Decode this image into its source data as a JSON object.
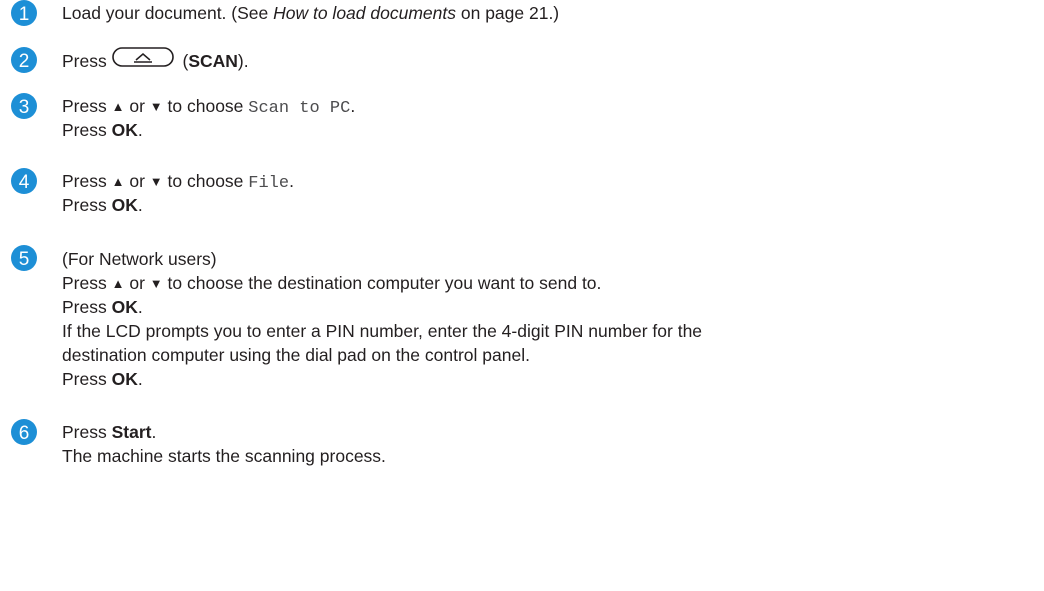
{
  "accent_color": "#1d8fd6",
  "step_icon": "step-number-badge",
  "scan_key_icon": "scan-key-icon",
  "steps": [
    {
      "number": "1",
      "line1": {
        "a": "Load your document. (See ",
        "italic": "How to load documents",
        "b": " on page 21.)"
      }
    },
    {
      "number": "2",
      "line1": {
        "a": "Press",
        "b": " (",
        "bold": "SCAN",
        "c": ")."
      }
    },
    {
      "number": "3",
      "line1": {
        "a": "Press ",
        "up": "▲",
        "or": " or ",
        "down": "▼",
        "b": " to choose ",
        "mono": "Scan to PC",
        "c": "."
      },
      "line2": {
        "a": "Press ",
        "bold": "OK",
        "b": "."
      }
    },
    {
      "number": "4",
      "line1": {
        "a": "Press ",
        "up": "▲",
        "or": " or ",
        "down": "▼",
        "b": " to choose ",
        "mono": "File",
        "c": "."
      },
      "line2": {
        "a": "Press ",
        "bold": "OK",
        "b": "."
      }
    },
    {
      "number": "5",
      "line1": "(For Network users)",
      "line2": {
        "a": "Press ",
        "up": "▲",
        "or": " or ",
        "down": "▼",
        "b": " to choose the destination computer you want to send to."
      },
      "line3": {
        "a": "Press ",
        "bold": "OK",
        "b": "."
      },
      "line4": "If the LCD prompts you to enter a PIN number, enter the 4-digit PIN number for the",
      "line5": "destination computer using the dial pad on the control panel.",
      "line6": {
        "a": "Press ",
        "bold": "OK",
        "b": "."
      }
    },
    {
      "number": "6",
      "line1": {
        "a": "Press ",
        "bold": "Start",
        "b": "."
      },
      "line2": "The machine starts the scanning process."
    }
  ]
}
